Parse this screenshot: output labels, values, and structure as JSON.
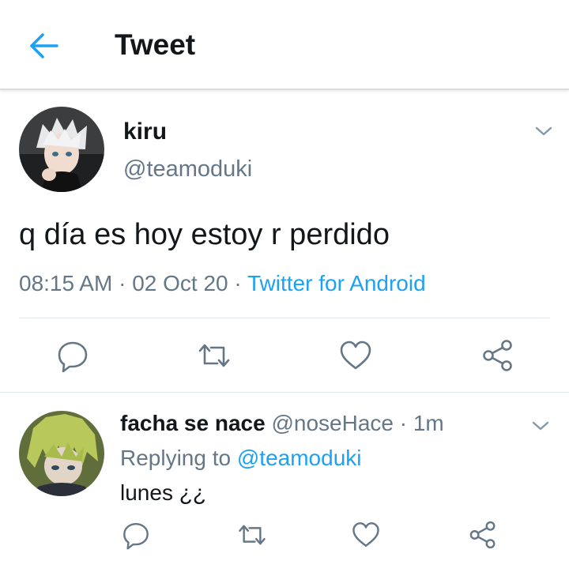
{
  "header": {
    "title": "Tweet",
    "back_icon": "arrow-left-icon"
  },
  "colors": {
    "accent": "#1da1f2",
    "secondary_text": "#657786",
    "primary_text": "#14171a",
    "divider": "#e1e8ed"
  },
  "tweet": {
    "author_name": "kiru",
    "author_handle": "@teamoduki",
    "text": "q día es hoy estoy r perdido",
    "time": "08:15 AM",
    "date": "02 Oct 20",
    "separator": "·",
    "source": "Twitter for Android",
    "actions": [
      "reply-icon",
      "retweet-icon",
      "like-icon",
      "share-icon"
    ]
  },
  "reply": {
    "author_name": "facha se nace",
    "author_handle": "@noseHace",
    "separator": "·",
    "time_ago": "1m",
    "replying_prefix": "Replying to",
    "replying_to": "@teamoduki",
    "text": "lunes ¿¿",
    "actions": [
      "reply-icon",
      "retweet-icon",
      "like-icon",
      "share-icon"
    ]
  }
}
